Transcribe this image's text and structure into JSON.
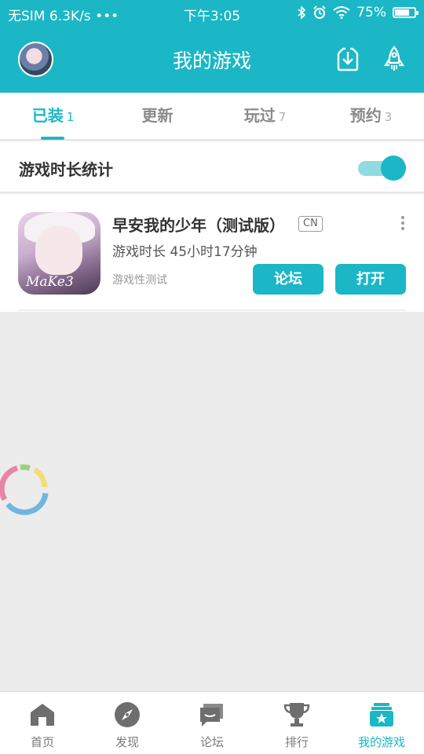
{
  "status_bar": {
    "carrier": "无SIM",
    "speed": "6.3K/s",
    "dots": "•••",
    "time": "下午3:05",
    "battery": "75%",
    "battery_level": 0.75
  },
  "header": {
    "title": "我的游戏",
    "icons": [
      "avatar",
      "download-icon",
      "rocket-icon"
    ]
  },
  "tabs": [
    {
      "label": "已装",
      "count": "1",
      "active": true
    },
    {
      "label": "更新",
      "count": "",
      "active": false
    },
    {
      "label": "玩过",
      "count": "7",
      "active": false
    },
    {
      "label": "预约",
      "count": "3",
      "active": false
    }
  ],
  "playtime_stats": {
    "label": "游戏时长统计",
    "enabled": true
  },
  "game": {
    "title": "早安我的少年（测试版）",
    "region_badge": "CN",
    "playtime": "游戏时长 45小时17分钟",
    "tag": "游戏性测试",
    "icon_text": "MaKe3",
    "forum_button": "论坛",
    "open_button": "打开"
  },
  "bottom_nav": [
    {
      "label": "首页",
      "icon": "home-icon",
      "active": false
    },
    {
      "label": "发现",
      "icon": "compass-icon",
      "active": false
    },
    {
      "label": "论坛",
      "icon": "chat-icon",
      "active": false
    },
    {
      "label": "排行",
      "icon": "trophy-icon",
      "active": false
    },
    {
      "label": "我的游戏",
      "icon": "my-games-icon",
      "active": true
    }
  ],
  "colors": {
    "accent": "#1bb7c6",
    "background": "#ececec",
    "inactive": "#8a8a8a"
  }
}
